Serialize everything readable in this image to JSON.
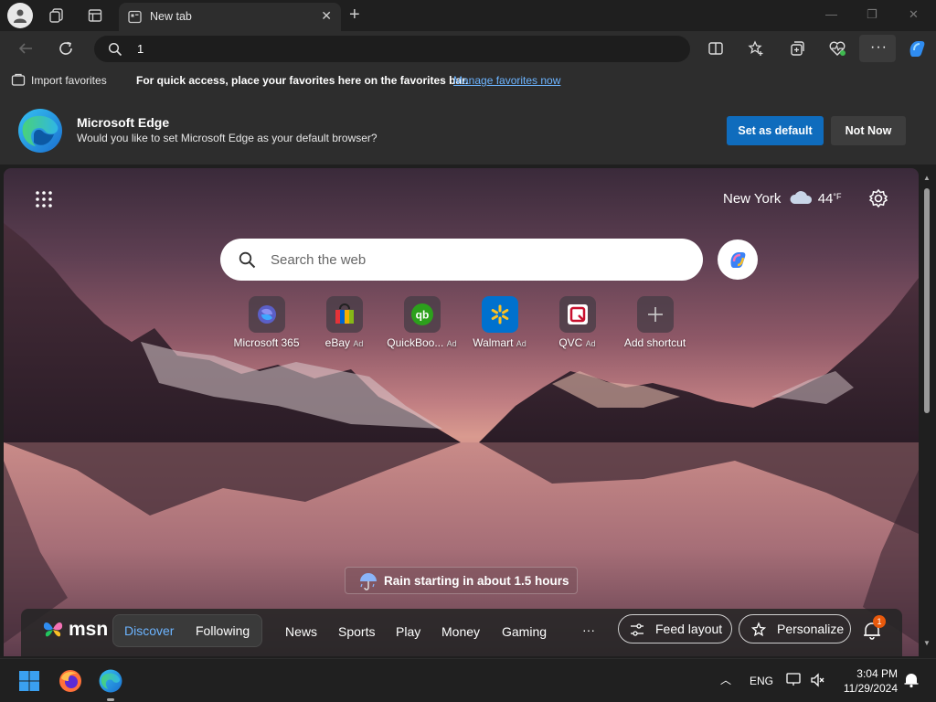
{
  "tab": {
    "title": "New tab"
  },
  "address": {
    "value": "1"
  },
  "favorites_bar": {
    "import_label": "Import favorites",
    "message": "For quick access, place your favorites here on the favorites bar.",
    "link": "Manage favorites now"
  },
  "banner": {
    "title": "Microsoft Edge",
    "subtitle": "Would you like to set Microsoft Edge as your default browser?",
    "primary": "Set as default",
    "secondary": "Not Now"
  },
  "weather": {
    "city": "New York",
    "temp": "44",
    "unit": "°F"
  },
  "search": {
    "placeholder": "Search the web"
  },
  "quick_links": [
    {
      "label": "Microsoft 365",
      "ad": ""
    },
    {
      "label": "eBay",
      "ad": "Ad"
    },
    {
      "label": "QuickBoo...",
      "ad": "Ad"
    },
    {
      "label": "Walmart",
      "ad": "Ad"
    },
    {
      "label": "QVC",
      "ad": "Ad"
    },
    {
      "label": "Add shortcut",
      "ad": ""
    }
  ],
  "rain_alert": "Rain starting in about 1.5 hours",
  "msn": {
    "logo": "msn",
    "tabs": [
      "Discover",
      "Following"
    ],
    "nav": [
      "News",
      "Sports",
      "Play",
      "Money",
      "Gaming"
    ],
    "more": "···",
    "feed_layout": "Feed layout",
    "personalize": "Personalize",
    "notification_count": "1"
  },
  "taskbar": {
    "lang": "ENG",
    "time": "3:04 PM",
    "date": "11/29/2024"
  },
  "colors": {
    "accent": "#0f6cbd",
    "link": "#6cb4ff",
    "msn_active": "#6cb4ff",
    "badge": "#e8590c"
  }
}
